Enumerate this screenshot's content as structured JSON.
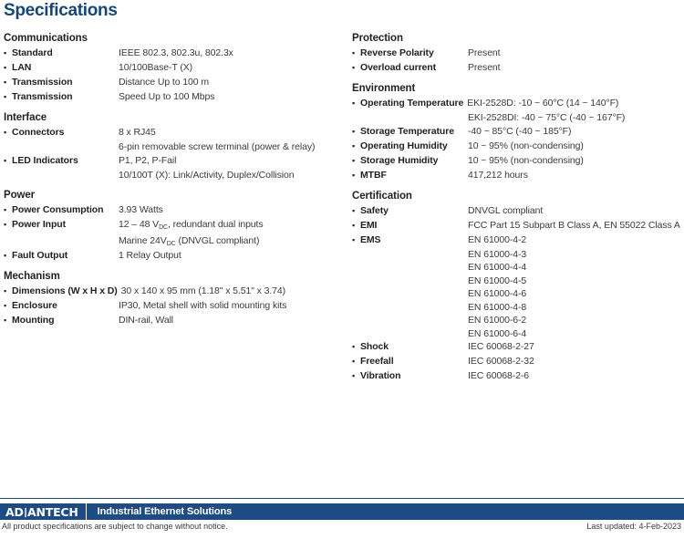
{
  "page": {
    "title": "Specifications"
  },
  "left_column": [
    {
      "title": "Communications",
      "rows": [
        {
          "label": "Standard",
          "value": "IEEE 802.3, 802.3u, 802.3x"
        },
        {
          "label": "LAN",
          "value": "10/100Base-T (X)"
        },
        {
          "label": "Transmission",
          "value": "Distance Up to 100 m"
        },
        {
          "label": "Transmission",
          "value": "Speed Up to 100 Mbps"
        }
      ]
    },
    {
      "title": "Interface",
      "rows": [
        {
          "label": "Connectors",
          "value": "8 x RJ45",
          "extra": [
            "6-pin removable screw terminal (power & relay)"
          ]
        },
        {
          "label": "LED Indicators",
          "value": "P1, P2, P-Fail",
          "extra": [
            "10/100T (X): Link/Activity, Duplex/Collision"
          ]
        }
      ]
    },
    {
      "title": "Power",
      "rows": [
        {
          "label": "Power Consumption",
          "value": "3.93 Watts"
        },
        {
          "label": "Power Input",
          "value_html": "12 – 48 V<sub>DC</sub>, redundant dual inputs",
          "extra_html": [
            "Marine 24V<sub>DC</sub> (DNVGL compliant)"
          ]
        },
        {
          "label": "Fault Output",
          "value": "1 Relay Output"
        }
      ]
    },
    {
      "title": "Mechanism",
      "rows": [
        {
          "label": "Dimensions (W x H x D)",
          "value": "30 x 140 x 95 mm (1.18\" x 5.51\" x 3.74)",
          "wide": true
        },
        {
          "label": "Enclosure",
          "value": "IP30, Metal shell with solid mounting kits"
        },
        {
          "label": "Mounting",
          "value": "DIN-rail, Wall"
        }
      ]
    }
  ],
  "right_column": [
    {
      "title": "Protection",
      "rows": [
        {
          "label": "Reverse Polarity",
          "value": "Present"
        },
        {
          "label": "Overload current",
          "value": "Present"
        }
      ]
    },
    {
      "title": "Environment",
      "rows": [
        {
          "label": "Operating Temperature",
          "value": "EKI-2528D: -10 ~ 60°C (14 ~ 140°F)",
          "extra": [
            "EKI-2528DI: -40 ~ 75°C (-40 ~ 167°F)"
          ],
          "wide": true
        },
        {
          "label": "Storage Temperature",
          "value": "-40 ~ 85°C (-40 ~ 185°F)"
        },
        {
          "label": "Operating Humidity",
          "value": "10 ~ 95% (non-condensing)"
        },
        {
          "label": "Storage Humidity",
          "value": "10 ~ 95% (non-condensing)"
        },
        {
          "label": "MTBF",
          "value": "417,212 hours"
        }
      ]
    },
    {
      "title": "Certification",
      "rows": [
        {
          "label": "Safety",
          "value": "DNVGL compliant"
        },
        {
          "label": "EMI",
          "value": "FCC Part 15 Subpart B Class A, EN 55022 Class A"
        },
        {
          "label": "EMS",
          "value": "EN 61000-4-2",
          "extra": [
            "EN 61000-4-3",
            "EN 61000-4-4",
            "EN 61000-4-5",
            "EN 61000-4-6",
            "EN 61000-4-8",
            "EN 61000-6-2",
            "EN 61000-6-4"
          ]
        },
        {
          "label": "Shock",
          "value": "IEC 60068-2-27"
        },
        {
          "label": "Freefall",
          "value": "IEC 60068-2-32"
        },
        {
          "label": "Vibration",
          "value": "IEC 60068-2-6"
        }
      ]
    }
  ],
  "footer": {
    "logo_pre": "AD",
    "logo_slash": "\\",
    "logo_post": "ANTECH",
    "tagline": "Industrial Ethernet Solutions",
    "note": "All product specifications are subject to change without notice.",
    "updated": "Last updated: 4-Feb-2023"
  },
  "colors": {
    "title_blue": "#15457f",
    "bar_blue": "#1d4b84",
    "text": "#231f20",
    "value_text": "#3a3a3a"
  }
}
